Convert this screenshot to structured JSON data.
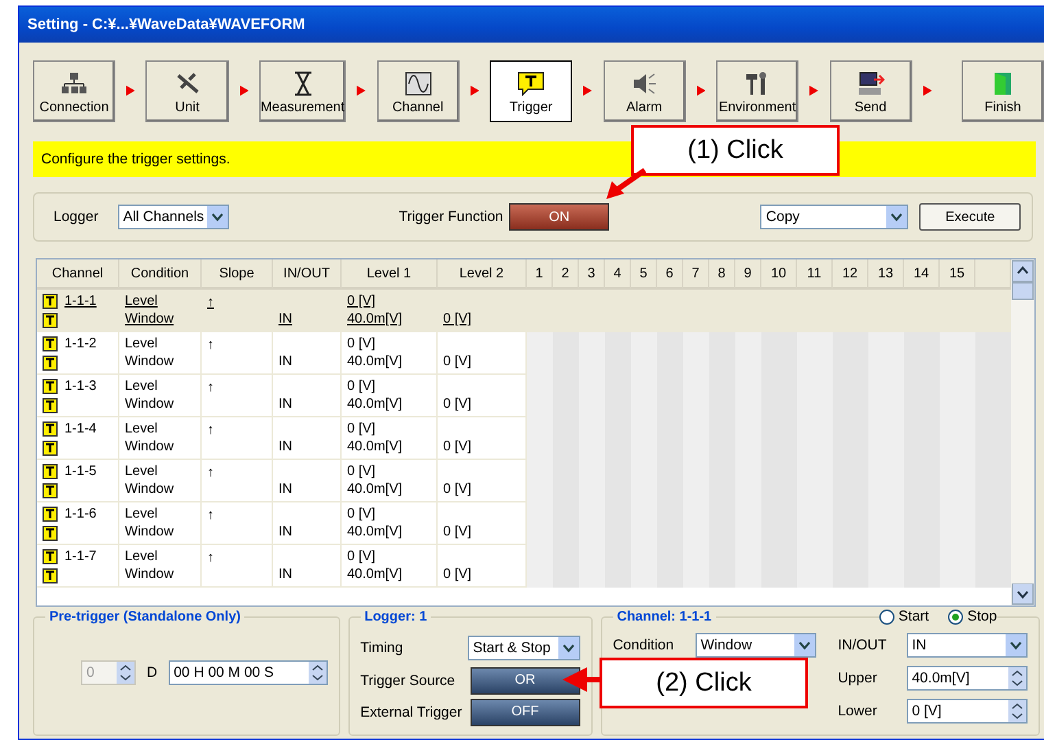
{
  "window": {
    "title": "Setting - C:¥...¥WaveData¥WAVEFORM"
  },
  "steps": [
    {
      "label": "Connection",
      "selected": false
    },
    {
      "label": "Unit",
      "selected": false
    },
    {
      "label": "Measurement",
      "selected": false
    },
    {
      "label": "Channel",
      "selected": false
    },
    {
      "label": "Trigger",
      "selected": true
    },
    {
      "label": "Alarm",
      "selected": false
    },
    {
      "label": "Environment",
      "selected": false
    },
    {
      "label": "Send",
      "selected": false
    }
  ],
  "finish": {
    "label": "Finish"
  },
  "hint": "Configure the trigger settings.",
  "controls": {
    "logger_label": "Logger",
    "logger_value": "All Channels",
    "trigger_function_label": "Trigger Function",
    "trigger_function": {
      "value": "ON",
      "on": true
    },
    "copy_value": "Copy",
    "execute": "Execute"
  },
  "table": {
    "columns": [
      "Channel",
      "Condition",
      "Slope",
      "IN/OUT",
      "Level 1",
      "Level 2",
      "1",
      "2",
      "3",
      "4",
      "5",
      "6",
      "7",
      "8",
      "9",
      "10",
      "11",
      "12",
      "13",
      "14",
      "15"
    ],
    "rows": [
      {
        "channel": "1-1-1",
        "condition": [
          "Level",
          "Window"
        ],
        "slope": "↑",
        "inout": "IN",
        "level1": [
          "0 [V]",
          "40.0m[V]"
        ],
        "level2": "0 [V]",
        "selected": true
      },
      {
        "channel": "1-1-2",
        "condition": [
          "Level",
          "Window"
        ],
        "slope": "↑",
        "inout": "IN",
        "level1": [
          "0 [V]",
          "40.0m[V]"
        ],
        "level2": "0 [V]",
        "selected": false
      },
      {
        "channel": "1-1-3",
        "condition": [
          "Level",
          "Window"
        ],
        "slope": "↑",
        "inout": "IN",
        "level1": [
          "0 [V]",
          "40.0m[V]"
        ],
        "level2": "0 [V]",
        "selected": false
      },
      {
        "channel": "1-1-4",
        "condition": [
          "Level",
          "Window"
        ],
        "slope": "↑",
        "inout": "IN",
        "level1": [
          "0 [V]",
          "40.0m[V]"
        ],
        "level2": "0 [V]",
        "selected": false
      },
      {
        "channel": "1-1-5",
        "condition": [
          "Level",
          "Window"
        ],
        "slope": "↑",
        "inout": "IN",
        "level1": [
          "0 [V]",
          "40.0m[V]"
        ],
        "level2": "0 [V]",
        "selected": false
      },
      {
        "channel": "1-1-6",
        "condition": [
          "Level",
          "Window"
        ],
        "slope": "↑",
        "inout": "IN",
        "level1": [
          "0 [V]",
          "40.0m[V]"
        ],
        "level2": "0 [V]",
        "selected": false
      },
      {
        "channel": "1-1-7",
        "condition": [
          "Level",
          "Window"
        ],
        "slope": "↑",
        "inout": "IN",
        "level1": [
          "0 [V]",
          "40.0m[V]"
        ],
        "level2": "0 [V]",
        "selected": false
      }
    ]
  },
  "pretrigger": {
    "title": "Pre-trigger (Standalone Only)",
    "days": "0",
    "days_unit": "D",
    "time": "00 H 00 M 00 S"
  },
  "logger": {
    "title": "Logger: 1",
    "timing_label": "Timing",
    "timing": "Start & Stop",
    "source_label": "Trigger Source",
    "source": {
      "value": "OR",
      "on": false
    },
    "external_label": "External Trigger",
    "external": {
      "value": "OFF",
      "on": false
    }
  },
  "channel": {
    "title": "Channel: 1-1-1",
    "radios": [
      {
        "label": "Start",
        "selected": false
      },
      {
        "label": "Stop",
        "selected": true
      }
    ],
    "condition_label": "Condition",
    "condition": "Window",
    "inout_label": "IN/OUT",
    "inout": "IN",
    "upper_label": "Upper",
    "upper": "40.0m[V]",
    "lower_label": "Lower",
    "lower": "0 [V]"
  },
  "callouts": [
    "(1) Click",
    "(2) Click"
  ]
}
